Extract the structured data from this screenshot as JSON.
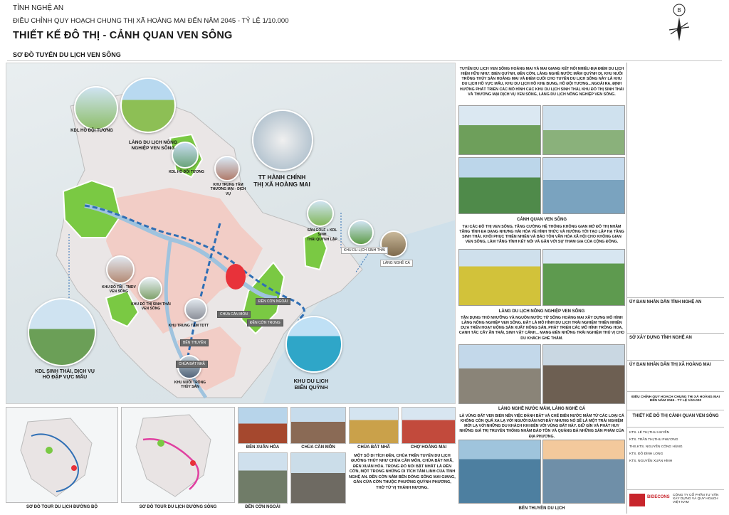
{
  "header": {
    "province": "TỈNH NGHỆ AN",
    "plan_title": "ĐIỀU CHỈNH QUY HOẠCH CHUNG THỊ XÃ HOÀNG MAI ĐẾN NĂM 2045 - TỶ LỆ 1/10.000",
    "sheet_title": "THIẾT KẾ ĐÔ THỊ - CẢNH QUAN VEN SÔNG"
  },
  "section": {
    "title": "SƠ ĐỒ TUYẾN DU LỊCH VEN SÔNG"
  },
  "map": {
    "labels": {
      "kdl_ho_doi_tuong_1": "KDL HỒ ĐỘI TƯƠNG",
      "lang_du_lich": "LÀNG DU LỊCH NÔNG\nNGHIỆP VEN SÔNG",
      "kdl_ho_doi_tuong_2": "KDL HỒ ĐỘI TƯƠNG",
      "khu_trung_tam": "KHU TRUNG TÂM\nTHƯƠNG MẠI - DỊCH VỤ",
      "tt_hanh_chinh": "TT HÀNH CHÍNH\nTHỊ XÃ HOÀNG MAI",
      "san_golf": "SÂN GOLF + KDL SINH\nTHÁI QUỲNH LẬP",
      "khu_du_lich_sinh_thai": "KHU DU LỊCH SINH THÁI",
      "lang_nghe_ca": "LÀNG NGHỀ CÁ",
      "khu_do_thi_ven_song": "KHU ĐÔ THỊ - TMDV\nVEN SÔNG",
      "khu_do_thi_sinh_thai": "KHU ĐÔ THỊ SINH THÁI\nVEN SÔNG",
      "khu_trung_tam_tdtt": "KHU TRUNG TÂM TDTT",
      "ben_thuyen": "BẾN THUYỀN",
      "chua_cam_mon": "CHÙA CẢN MÔN",
      "den_con_ngoai": "ĐỀN CỜN NGOÀI",
      "den_con_trong": "ĐỀN CỜN TRONG",
      "chua_bat_nha": "CHÙA BÁT NHÃ",
      "khu_nuoi_trong": "KHU NUÔI TRỒNG\nTHỦY SẢN",
      "kdl_sinh_thai": "KDL SINH THÁI, DỊCH VỤ\nHỒ ĐẬP VỰC MẤU",
      "khu_du_lich_bien": "KHU DU LỊCH\nBIỂN QUỲNH"
    }
  },
  "bottom": {
    "tour_duong_bo": "SƠ ĐỒ TOUR DU LỊCH ĐƯỜNG BỘ",
    "tour_duong_song": "SƠ ĐỒ TOUR DU LỊCH ĐƯỜNG SÔNG",
    "den_xuan_hoa": "ĐỀN XUÂN HÒA",
    "chua_can_mon": "CHÙA CẦN MÔN",
    "den_con_ngoai": "ĐỀN CỜN NGOÀI",
    "chua_bat_nha": "CHÙA BÁT NHÃ",
    "cho_hoang_mai": "CHỢ HOÀNG MAI",
    "heritage_text": "MỘT SỐ DI TÍCH ĐỀN, CHÙA TRÊN TUYẾN DU LỊCH ĐƯỜNG THỦY NHƯ CHÙA CẦN MÔN, CHÙA BÁT NHÃ, ĐỀN XUÂN HÒA. TRONG ĐÓ NỔI BẬT NHẤT LÀ ĐỀN CỜN, MỘT TRONG NHỮNG DI TÍCH TÂM LINH CỦA TỈNH NGHỆ AN. ĐỀN CỜN NẰM BÊN DÒNG SÔNG MAI GIANG, GẦN CỬA CỜN THUỘC PHƯỜNG QUỲNH PHƯƠNG, THỜ TỨ VỊ THÁNH NƯƠNG."
  },
  "right_column": {
    "intro": "TUYẾN DU LỊCH VEN SÔNG HOÀNG MAI VÀ MAI GIANG KẾT NỐI NHIỀU ĐỊA ĐIỂM DU LỊCH HIỆN HỮU NHƯ: BIỂN QUỲNH, ĐỀN CỜN, LÀNG NGHỀ NƯỚC MẮM QUỲNH DỊ, KHU NUÔI TRỒNG THỦY SẢN HOÀNG MAI VÀ ĐIỂM CUỐI CHO TUYẾN DU LỊCH SÔNG NÀY LÀ KHU DU LỊCH HỒ VỰC MẤU, KHU DU LỊCH HỒ KHE BUNG, HỒ ĐỘI TƯƠNG...NGOÀI RA, ĐỊNH HƯỚNG PHÁT TRIỂN CÁC MÔ HÌNH CÁC KHU DU LỊCH SINH THÁI, KHU ĐÔ THỊ SINH THÁI VÀ THƯƠNG MẠI DỊCH VỤ VEN SÔNG, LÀNG DU LỊCH NÔNG NGHIỆP VEN SÔNG.",
    "canh_quan_title": "CẢNH QUAN VEN SÔNG",
    "canh_quan_text": "TẠI CÁC ĐÔ THỊ VEN SÔNG, TĂNG CƯỜNG HỆ THỐNG KHÔNG GIAN MỞ ĐÔ THỊ NHẰM TĂNG TÍNH ĐA DẠNG NHƯNG HÀI HÒA VỀ HÌNH THỨC VÀ HƯỚNG TỚI TẠO LẬP HẠ TẦNG SINH THÁI. KHÔI PHỤC THIÊN NHIÊN VÀ BẢO TỒN VĂN HÓA XÃ HỘI CHO KHÔNG GIAN VEN SÔNG, LÀM TĂNG TÍNH KẾT NỐI VÀ GẮN VỚI SỰ THAM GIA CỦA CỘNG ĐỒNG.",
    "lang_du_lich_title": "LÀNG DU LỊCH NÔNG NGHIỆP VEN SÔNG",
    "lang_du_lich_text": "TẬN DỤNG THỔ NHƯỠNG VÀ NGUỒN NƯỚC TỪ SÔNG HOÀNG MAI XÂY DỰNG MÔ HÌNH LÀNG NÔNG NGHIỆP VEN SÔNG. ĐÂY LÀ MÔ HÌNH DU LỊCH TRẢI NGHIỆM THIÊN NHIÊN DỰA TRÊN HOẠT ĐỘNG SẢN XUẤT NÔNG SẢN, PHÁT TRIỂN CÁC MÔ HÌNH TRỒNG HOA, CANH TÁC CÂY ĂN TRÁI, SINH VẬT CẢNH... MANG ĐẾN NHỮNG TRẢI NGHIỆM THÚ VỊ CHO DU KHÁCH GHÉ THĂM.",
    "lang_nghe_title": "LÀNG NGHỀ NƯỚC MẮM, LÀNG NGHỀ CÁ",
    "lang_nghe_text": "LÀ VÙNG ĐẤT VEN BIỂN NÊN VIỆC ĐÁNH BẮT VÀ CHẾ BIẾN NƯỚC MẮM TỪ CÁC LOẠI CÁ KHÔNG CÒN QUÁ XA LẠ VỚI NGƯỜI DÂN NƠI ĐÂY NHƯNG NÓ SẼ LÀ MỘT TRẢI NGHIỆM MỚI LẠ VỚI NHỮNG DU KHÁCH KHI ĐẾN VỚI VÙNG ĐẤT NÀY. GIỮ GÌN VÀ PHÁT HUY NHỮNG GIÁ TRỊ TRUYỀN THỐNG NHẰM BẢO TỒN VÀ QUẢNG BÁ NHỮNG SẢN PHẨM CỦA ĐỊA PHƯƠNG.",
    "ben_thuyen_caption": "BẾN THUYỀN DU LỊCH"
  },
  "title_block": {
    "approver": "ỦY BAN NHÂN DÂN TỈNH NGHỆ AN",
    "appraiser": "SỞ XÂY DỰNG TỈNH NGHỆ AN",
    "organizer": "ỦY BAN NHÂN DÂN THỊ XÃ HOÀNG MAI",
    "project": "ĐIỀU CHỈNH QUY HOẠCH CHUNG THỊ XÃ HOÀNG MAI ĐẾN NĂM 2045 - TỶ LỆ 1/10.000",
    "drawing": "THIẾT KẾ ĐÔ THỊ CẢNH QUAN VEN SÔNG",
    "designer_1": "KTS. LÊ THỊ THU HUYỀN",
    "designer_2": "KTS. TRẦN THỊ THU PHƯƠNG",
    "checker": "THS.KTS. NGUYỄN CÔNG HÙNG",
    "manager": "KTS. ĐỖ ĐÌNH LONG",
    "director": "KTS. NGUYỄN XUÂN HÌNH",
    "consultant": "CÔNG TY CỔ PHẦN TƯ VẤN XÂY DỰNG VÀ QUY HOẠCH VIỆT NAM",
    "brand": "BIDECONS"
  },
  "colors": {
    "route_blue": "#2f6fb5",
    "urban_pink": "#f3c8c0",
    "green_zone": "#7ac943",
    "sea": "#d9e7ee"
  }
}
